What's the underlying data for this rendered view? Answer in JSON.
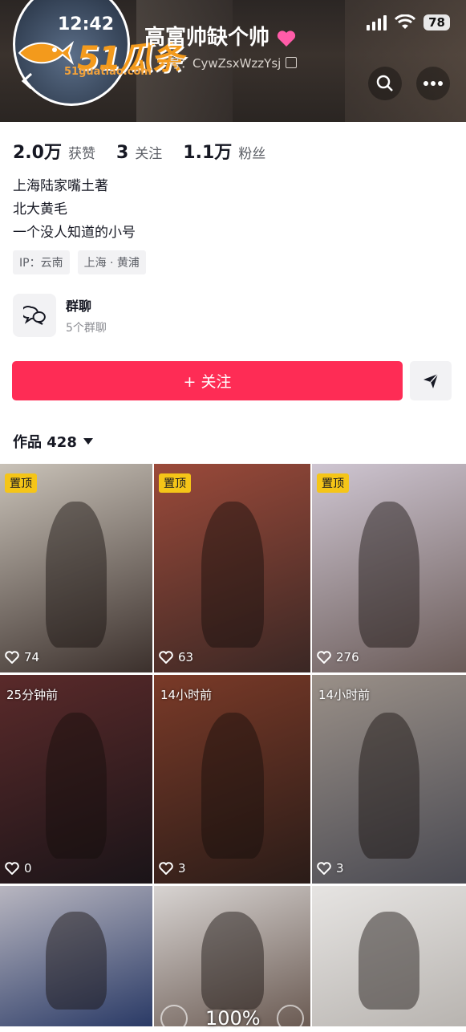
{
  "status_bar": {
    "time": "12:42",
    "battery": "78"
  },
  "watermark": {
    "brand": "51瓜条",
    "url": "51guatiao.com"
  },
  "profile": {
    "name": "高富帅缺个帅",
    "uid_label": "号：CywZsxWzzYsj",
    "stats": [
      {
        "value": "2.0万",
        "label": "获赞"
      },
      {
        "value": "3",
        "label": "关注"
      },
      {
        "value": "1.1万",
        "label": "粉丝"
      }
    ],
    "bio": [
      "上海陆家嘴土著",
      "北大黄毛",
      "一个没人知道的小号"
    ],
    "tags": [
      "IP：云南",
      "上海 · 黄浦"
    ]
  },
  "group_chat": {
    "title": "群聊",
    "subtitle": "5个群聊"
  },
  "actions": {
    "follow_label": "+ 关注"
  },
  "works": {
    "label": "作品 428"
  },
  "videos": [
    {
      "badge": "置顶",
      "badge_type": "pin",
      "likes": "74",
      "colors": [
        "#c9c2b8",
        "#3b302c"
      ]
    },
    {
      "badge": "置顶",
      "badge_type": "pin",
      "likes": "63",
      "colors": [
        "#9b4a3a",
        "#3a2724"
      ]
    },
    {
      "badge": "置顶",
      "badge_type": "pin",
      "likes": "276",
      "colors": [
        "#cfc6d2",
        "#6a5b58"
      ]
    },
    {
      "badge": "25分钟前",
      "badge_type": "time",
      "likes": "0",
      "colors": [
        "#5a2a2a",
        "#1a1418"
      ]
    },
    {
      "badge": "14小时前",
      "badge_type": "time",
      "likes": "3",
      "colors": [
        "#7a3a28",
        "#2a1c18"
      ]
    },
    {
      "badge": "14小时前",
      "badge_type": "time",
      "likes": "3",
      "colors": [
        "#9a9088",
        "#4a4a52"
      ]
    },
    {
      "badge": "",
      "badge_type": "none",
      "likes": "",
      "colors": [
        "#b8b6c0",
        "#2a3a66"
      ]
    },
    {
      "badge": "",
      "badge_type": "none",
      "likes": "",
      "colors": [
        "#d8d4d2",
        "#6a5a52"
      ]
    },
    {
      "badge": "",
      "badge_type": "none",
      "likes": "",
      "colors": [
        "#e6e4e2",
        "#b8b4b0"
      ]
    }
  ],
  "zoom": "100%",
  "icons": [
    "back-icon",
    "search-icon",
    "more-icon",
    "group-chat-icon",
    "share-icon",
    "heart-icon",
    "copy-icon",
    "signal-icon",
    "wifi-icon"
  ]
}
